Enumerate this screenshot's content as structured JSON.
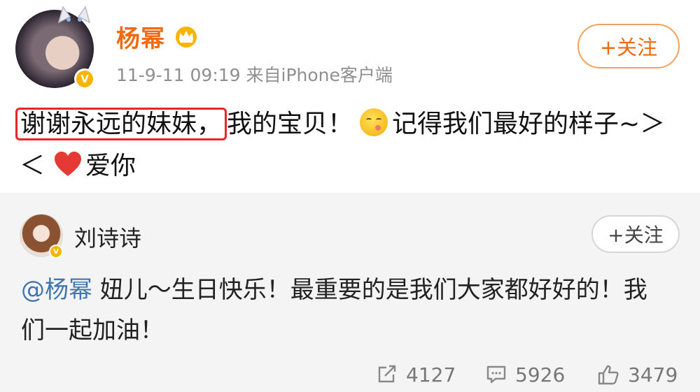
{
  "post": {
    "user_name": "杨幂",
    "vip_badge": "V",
    "meta": "11-9-11 09:19  来自iPhone客户端",
    "follow_label": "+关注",
    "text_highlight": "谢谢永远的妹妹，",
    "text_part1": "我的宝贝！",
    "text_part2": "记得我们最好的样子~＞＜",
    "text_part3": "爱你",
    "icons": [
      "crown-icon",
      "kiss-emoji-icon",
      "heart-icon",
      "cat-ears-decoration"
    ]
  },
  "repost": {
    "user_name": "刘诗诗",
    "vip_badge": "V",
    "follow_label": "+关注",
    "mention": "@杨幂",
    "text": " 妞儿～生日快乐！最重要的是我们大家都好好的！我们一起加油！",
    "stats": {
      "repost_count": "4127",
      "comment_count": "5926",
      "like_count": "3479"
    }
  },
  "colors": {
    "brand_orange": "#f06a12",
    "highlight_red": "#e8262a",
    "mention_blue": "#3f76b0",
    "repost_bg": "#f4f4f4"
  }
}
